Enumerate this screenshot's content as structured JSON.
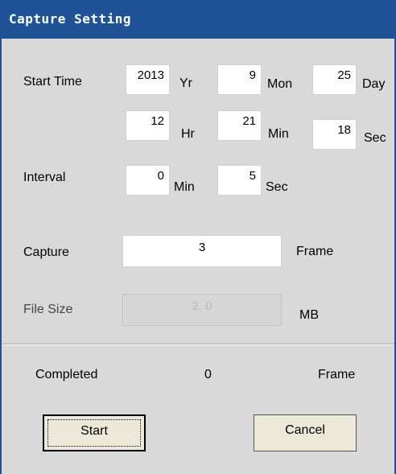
{
  "window": {
    "title": "Capture Setting"
  },
  "start_time": {
    "label": "Start Time",
    "year": {
      "value": "2013",
      "unit": "Yr"
    },
    "month": {
      "value": "9",
      "unit": "Mon"
    },
    "day": {
      "value": "25",
      "unit": "Day"
    },
    "hour": {
      "value": "12",
      "unit": "Hr"
    },
    "minute": {
      "value": "21",
      "unit": "Min"
    },
    "second": {
      "value": "18",
      "unit": "Sec"
    }
  },
  "interval": {
    "label": "Interval",
    "minutes": {
      "value": "0",
      "unit": "Min"
    },
    "seconds": {
      "value": "5",
      "unit": "Sec"
    }
  },
  "capture": {
    "label": "Capture",
    "value": "3",
    "unit": "Frame"
  },
  "file_size": {
    "label": "File Size",
    "value": "2. 0",
    "unit": "MB"
  },
  "completed": {
    "label": "Completed",
    "value": "0",
    "unit": "Frame"
  },
  "buttons": {
    "start": "Start",
    "cancel": "Cancel"
  }
}
